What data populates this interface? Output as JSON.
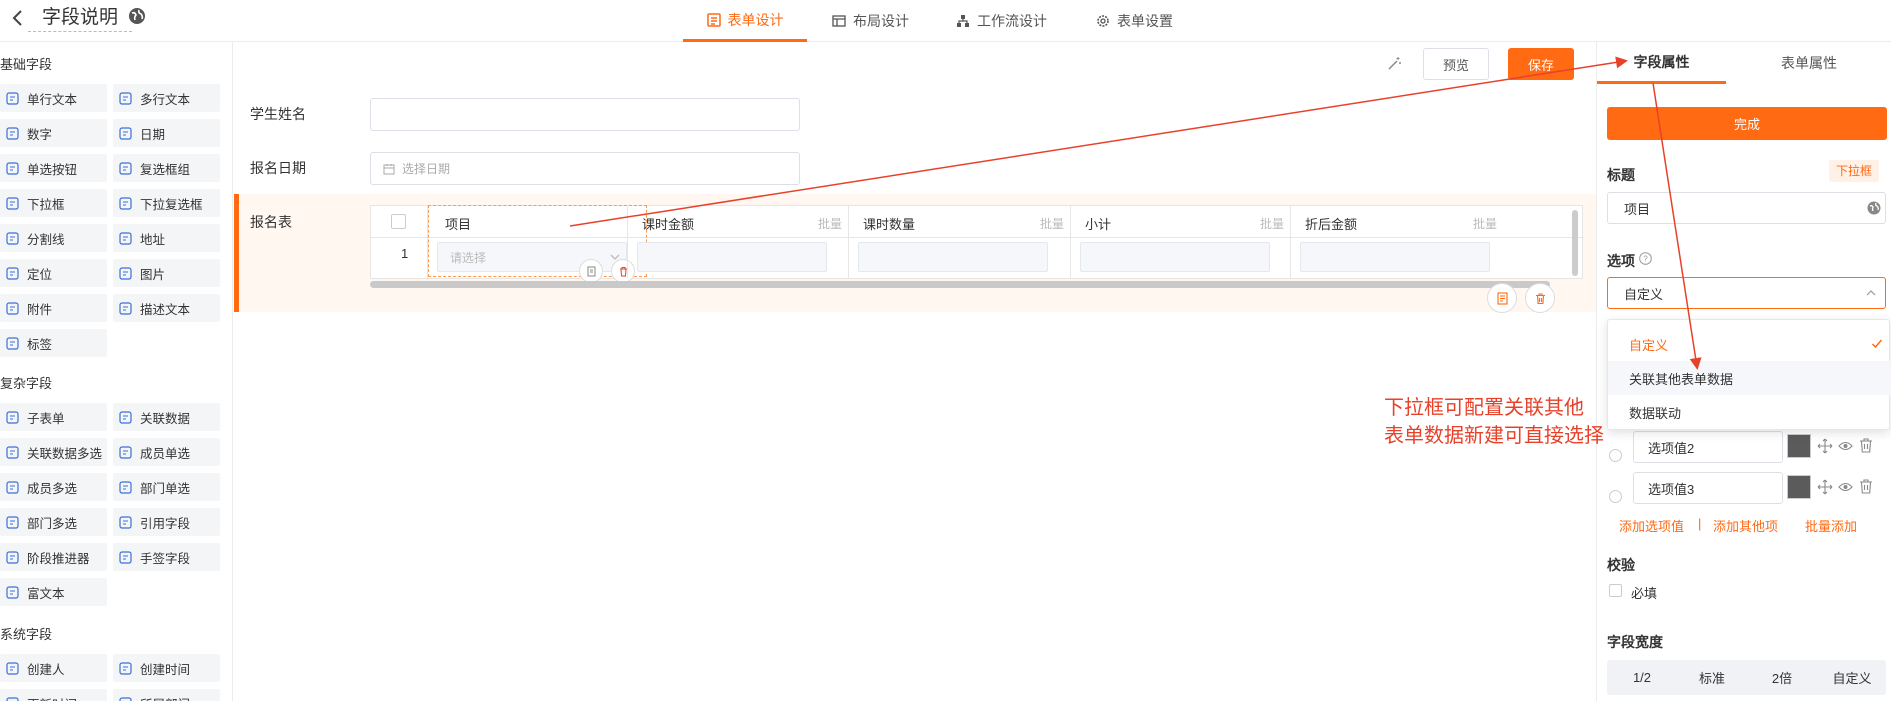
{
  "header": {
    "title": "字段说明",
    "tabs": [
      {
        "label": "表单设计",
        "active": true
      },
      {
        "label": "布局设计",
        "active": false
      },
      {
        "label": "工作流设计",
        "active": false
      },
      {
        "label": "表单设置",
        "active": false
      }
    ]
  },
  "left": {
    "basic_title": "基础字段",
    "basic": [
      "单行文本",
      "多行文本",
      "数字",
      "日期",
      "单选按钮",
      "复选框组",
      "下拉框",
      "下拉复选框",
      "分割线",
      "地址",
      "定位",
      "图片",
      "附件",
      "描述文本",
      "标签"
    ],
    "complex_title": "复杂字段",
    "complex": [
      "子表单",
      "关联数据",
      "关联数据多选",
      "成员单选",
      "成员多选",
      "部门单选",
      "部门多选",
      "引用字段",
      "阶段推进器",
      "手签字段",
      "富文本"
    ],
    "system_title": "系统字段",
    "system": [
      "创建人",
      "创建时间",
      "更新时间",
      "所属部门"
    ]
  },
  "canvas": {
    "preview_label": "预览",
    "save_label": "保存",
    "field1_label": "学生姓名",
    "field2_label": "报名日期",
    "field2_placeholder": "选择日期",
    "subform_label": "报名表",
    "columns": [
      {
        "name": "项目",
        "batch": ""
      },
      {
        "name": "课时金额",
        "batch": "批量"
      },
      {
        "name": "课时数量",
        "batch": "批量"
      },
      {
        "name": "小计",
        "batch": "批量"
      },
      {
        "name": "折后金额",
        "batch": "批量"
      }
    ],
    "row_number": "1",
    "select_placeholder": "请选择"
  },
  "right": {
    "tabs": [
      {
        "label": "字段属性",
        "active": true
      },
      {
        "label": "表单属性",
        "active": false
      }
    ],
    "done_label": "完成",
    "title_label": "标题",
    "type_badge": "下拉框",
    "title_value": "项目",
    "options_label": "选项",
    "options_mode": "自定义",
    "dropdown": [
      {
        "label": "自定义",
        "selected": true
      },
      {
        "label": "关联其他表单数据",
        "selected": false
      },
      {
        "label": "数据联动",
        "selected": false
      }
    ],
    "option_values": [
      "选项值2",
      "选项值3"
    ],
    "add_option": "添加选项值",
    "add_other": "添加其他项",
    "batch_add": "批量添加",
    "separator": "|",
    "validate_label": "校验",
    "required_label": "必填",
    "width_label": "字段宽度",
    "width_options": [
      "1/2",
      "标准",
      "2倍",
      "自定义"
    ]
  },
  "annotation": {
    "line1": "下拉框可配置关联其他",
    "line2": "表单数据新建可直接选择"
  },
  "colors": {
    "accent": "#ff6a13",
    "annotation": "#e8412a",
    "field_bg": "#f4f5f7"
  }
}
